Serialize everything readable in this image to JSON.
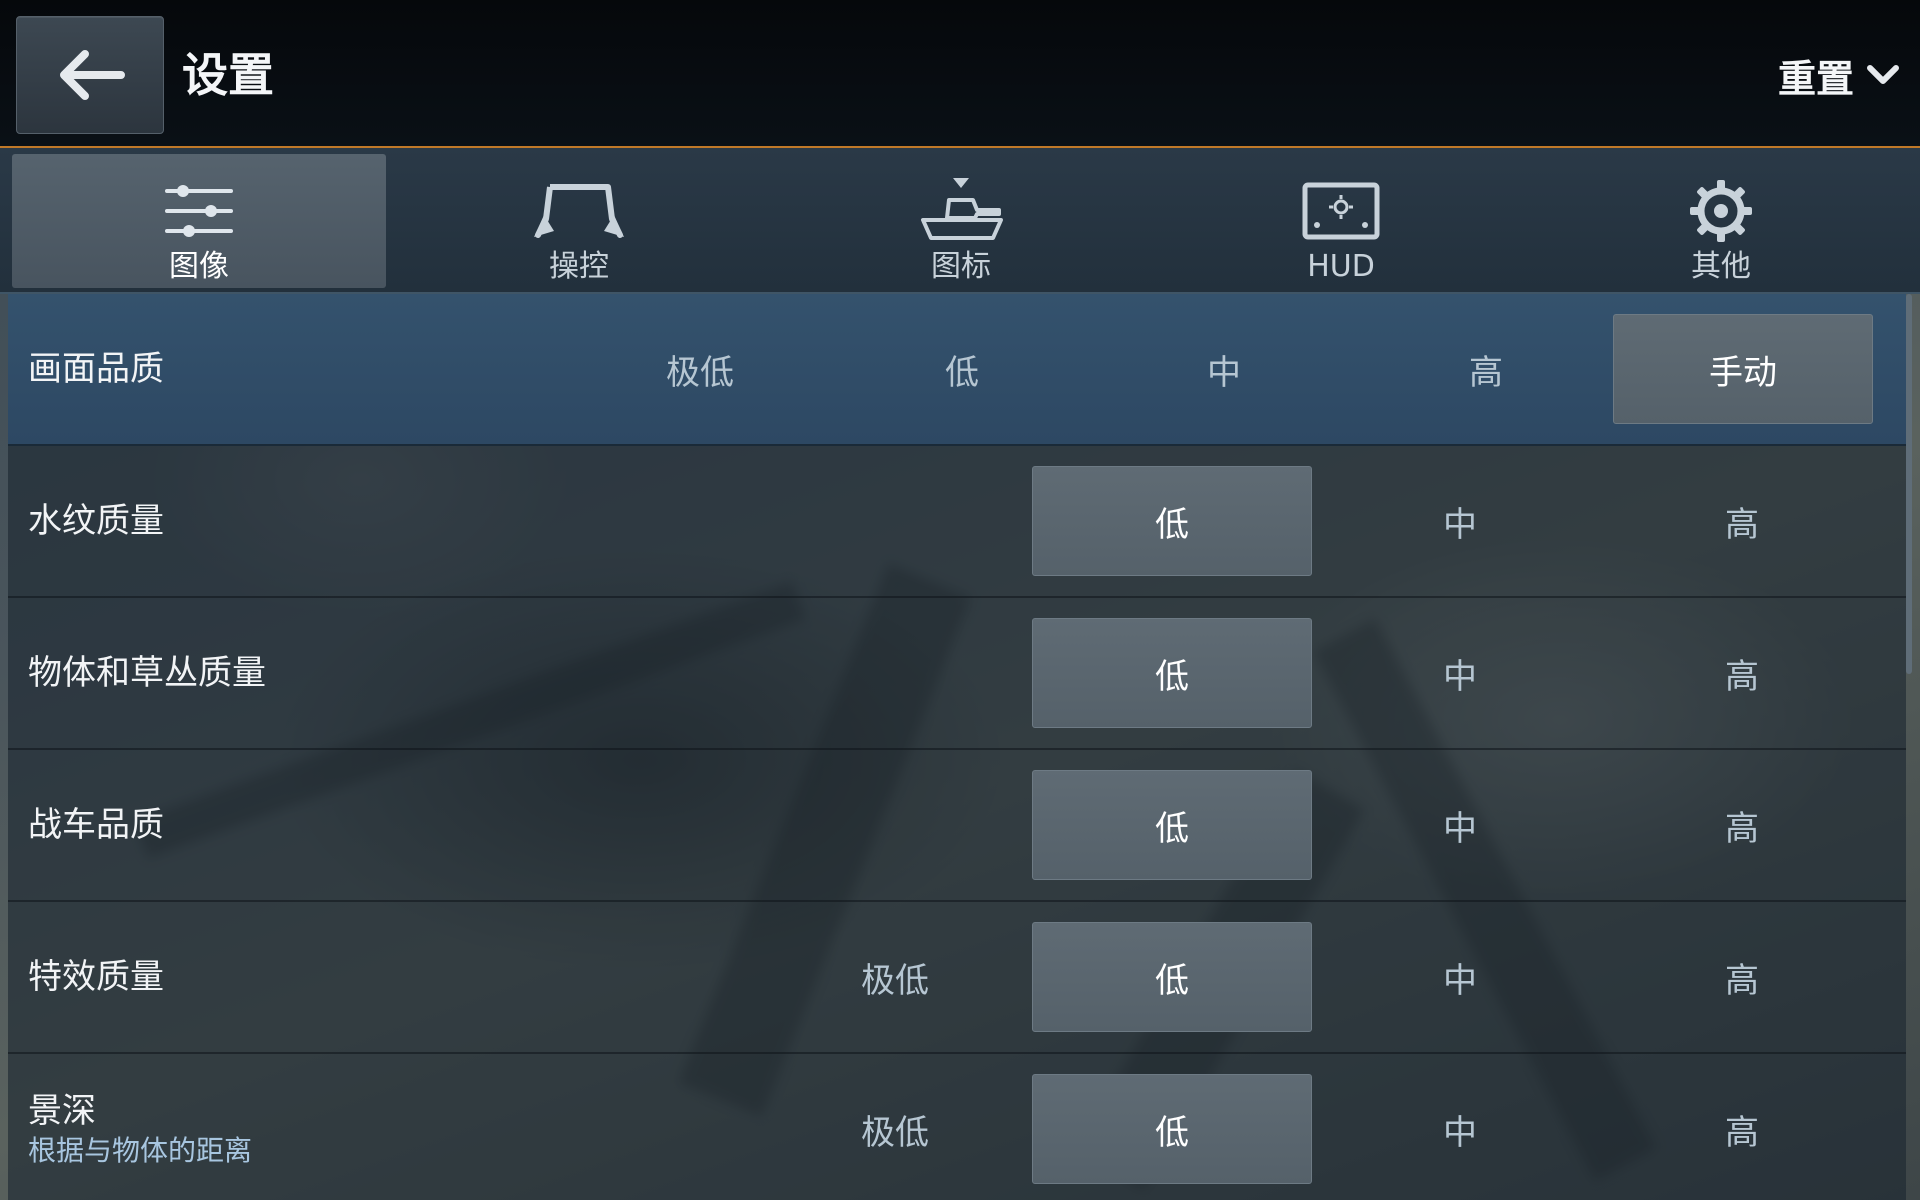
{
  "header": {
    "title": "设置",
    "reset_label": "重置",
    "icons": {
      "back": "arrow-left-icon",
      "reset_dropdown": "chevron-down-icon"
    }
  },
  "tabs": [
    {
      "label": "图像",
      "icon": "sliders-icon",
      "active": true
    },
    {
      "label": "操控",
      "icon": "controller-icon",
      "active": false
    },
    {
      "label": "图标",
      "icon": "tank-marker-icon",
      "active": false
    },
    {
      "label": "HUD",
      "icon": "hud-screen-icon",
      "active": false
    },
    {
      "label": "其他",
      "icon": "gear-icon",
      "active": false
    }
  ],
  "settings": [
    {
      "label": "画面品质",
      "options": [
        "极低",
        "低",
        "中",
        "高",
        "手动"
      ],
      "selected": "手动"
    },
    {
      "label": "水纹质量",
      "options": [
        "低",
        "中",
        "高"
      ],
      "selected": "低"
    },
    {
      "label": "物体和草丛质量",
      "options": [
        "低",
        "中",
        "高"
      ],
      "selected": "低"
    },
    {
      "label": "战车品质",
      "options": [
        "低",
        "中",
        "高"
      ],
      "selected": "低"
    },
    {
      "label": "特效质量",
      "options": [
        "极低",
        "低",
        "中",
        "高"
      ],
      "selected": "低"
    },
    {
      "label": "景深",
      "sublabel": "根据与物体的距离",
      "options": [
        "极低",
        "低",
        "中",
        "高"
      ],
      "selected": "低"
    }
  ],
  "colors": {
    "accent_line": "#c07828",
    "highlight_row": "#34526d",
    "selected_option": "#5f6b74",
    "sublabel": "#a8c6e0"
  }
}
